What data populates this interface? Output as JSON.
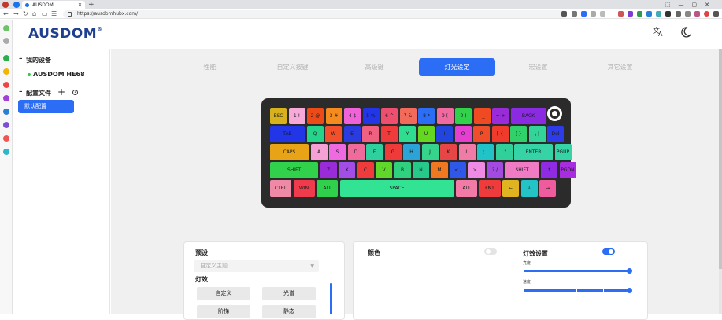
{
  "browser": {
    "tab_title": "AUSDOM",
    "url": "https://ausdomhubx.com/"
  },
  "app": {
    "logo": "AUSDOM"
  },
  "sidebar": {
    "devices_title": "我的设备",
    "device_name": "AUSDOM HE68",
    "profiles_title": "配置文件",
    "active_profile": "默认配置"
  },
  "nav_tabs": [
    "性能",
    "自定义按键",
    "高级键",
    "灯光设定",
    "宏设置",
    "其它设置"
  ],
  "active_tab": "灯光设定",
  "keyboard": {
    "rows": [
      [
        [
          "ESC",
          "#d8b21c"
        ],
        [
          "1 !",
          "#f7a9d9"
        ],
        [
          "2 @",
          "#ec4a16"
        ],
        [
          "3 #",
          "#f58a1e"
        ],
        [
          "4 $",
          "#f062d8"
        ],
        [
          "5 %",
          "#2236e8"
        ],
        [
          "6 ^",
          "#ef4f6f"
        ],
        [
          "7 &",
          "#f26a5a"
        ],
        [
          "8 *",
          "#2c6df5"
        ],
        [
          "9 (",
          "#f06aa0"
        ],
        [
          "0 )",
          "#31d14b"
        ],
        [
          "- _",
          "#f04a22"
        ],
        [
          "= +",
          "#9a2bd9"
        ],
        [
          "BACK",
          "#8a2be2"
        ]
      ],
      [
        [
          "TAB",
          "#2236e8"
        ],
        [
          "Q",
          "#25d48a"
        ],
        [
          "W",
          "#f2502a"
        ],
        [
          "E",
          "#2a3be0"
        ],
        [
          "R",
          "#f06080"
        ],
        [
          "T",
          "#ef3b3b"
        ],
        [
          "Y",
          "#30dc8f"
        ],
        [
          "U",
          "#64d821"
        ],
        [
          "I",
          "#2245e0"
        ],
        [
          "O",
          "#e53fd2"
        ],
        [
          "P",
          "#f04e2a"
        ],
        [
          "[ {",
          "#ef3b2c"
        ],
        [
          "] }",
          "#30d06a"
        ],
        [
          "\\ |",
          "#33d39a"
        ],
        [
          "Del",
          "#2d3be8"
        ]
      ],
      [
        [
          "CAPS",
          "#e8a316"
        ],
        [
          "A",
          "#f6a1d6"
        ],
        [
          "S",
          "#ef6ae0"
        ],
        [
          "D",
          "#f06b9b"
        ],
        [
          "F",
          "#2ed19d"
        ],
        [
          "G",
          "#ef3a3a"
        ],
        [
          "H",
          "#2ba3d6"
        ],
        [
          "J",
          "#35d38c"
        ],
        [
          "K",
          "#e84646"
        ],
        [
          "L",
          "#f07ba6"
        ],
        [
          "; :",
          "#22c3c7"
        ],
        [
          "' \"",
          "#31d09b"
        ],
        [
          "ENTER",
          "#36d3a6"
        ],
        [
          "PGUP",
          "#36d3a6"
        ]
      ],
      [
        [
          "SHIFT",
          "#31d14b"
        ],
        [
          "Z",
          "#9a2bd9"
        ],
        [
          "X",
          "#a24de6"
        ],
        [
          "C",
          "#ef3b3b"
        ],
        [
          "V",
          "#5fd82a"
        ],
        [
          "B",
          "#2fd07e"
        ],
        [
          "N",
          "#26c98a"
        ],
        [
          "M",
          "#f07820"
        ],
        [
          "< ,",
          "#2f58e8"
        ],
        [
          "> .",
          "#ef8be3"
        ],
        [
          "? /",
          "#a34ae0"
        ],
        [
          "SHIFT",
          "#ef7bc4"
        ],
        [
          "↑",
          "#8f2be2"
        ],
        [
          "PGDN",
          "#a92de0"
        ]
      ],
      [
        [
          "CTRL",
          "#ef8aa6"
        ],
        [
          "WIN",
          "#ef3b4c"
        ],
        [
          "ALT",
          "#2fd04c"
        ],
        [
          "SPACE",
          "#31e392"
        ],
        [
          "ALT",
          "#f17aa6"
        ],
        [
          "FN1",
          "#ef3b3b"
        ],
        [
          "←",
          "#e0b420"
        ],
        [
          "↓",
          "#23c3c6"
        ],
        [
          "→",
          "#ef5c9e"
        ]
      ]
    ]
  },
  "panels": {
    "preset": {
      "title": "预设",
      "theme_placeholder": "自定义主题",
      "effects_title": "灯效",
      "effects": [
        "自定义",
        "光谱",
        "阶梯",
        "静态"
      ]
    },
    "color": {
      "title": "颜色"
    },
    "effect_settings": {
      "title": "灯效设置",
      "brightness_label": "亮度",
      "speed_label": "速度",
      "brightness_value": 1.0,
      "speed_value": 1.0
    }
  },
  "colors": {
    "accent": "#2c6df5",
    "logo": "#1f3f8f",
    "keyboard_frame": "#2b2b2b"
  },
  "icons": [
    "translate-icon",
    "dark-mode-icon"
  ]
}
